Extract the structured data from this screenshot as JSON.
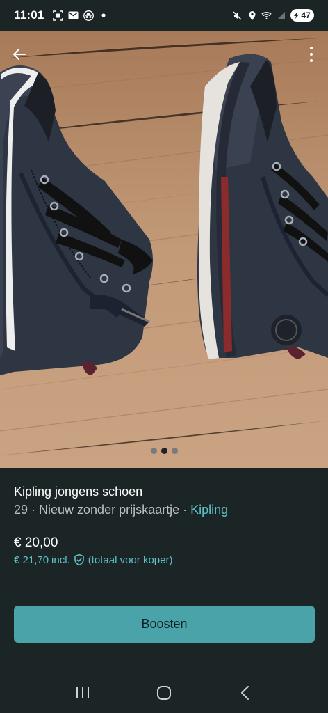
{
  "status_bar": {
    "time": "11:01",
    "battery": "47",
    "icons": [
      "screenshot-icon",
      "mail-icon",
      "incognito-icon",
      "dot-icon",
      "mute-icon",
      "location-icon",
      "wifi-icon",
      "signal-icon",
      "battery-icon"
    ]
  },
  "photo": {
    "back_icon": "arrow-left-icon",
    "more_icon": "more-vertical-icon",
    "pager": {
      "count": 3,
      "active": 1
    }
  },
  "listing": {
    "title": "Kipling jongens schoen",
    "meta_prefix": "29 · Nieuw zonder prijskaartje · ",
    "brand": "Kipling",
    "price": "€ 20,00",
    "price_incl": "€ 21,70",
    "incl_label": "incl.",
    "buyer_note": "(totaal voor koper)"
  },
  "actions": {
    "boost_label": "Boosten"
  },
  "colors": {
    "background": "#1b2526",
    "accent": "#5fc2c9",
    "button": "#4aa3a9"
  },
  "navbar": {
    "icons": [
      "recent-apps-icon",
      "home-icon",
      "back-icon"
    ]
  }
}
